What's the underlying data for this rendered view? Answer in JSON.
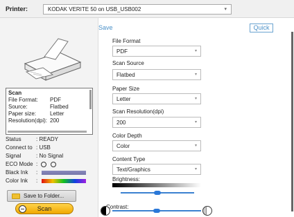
{
  "printer": {
    "label": "Printer:",
    "selected": "KODAK VERITE 50 on USB_USB002"
  },
  "scan_summary": {
    "title": "Scan",
    "rows": [
      {
        "key": "File Format:",
        "value": "PDF"
      },
      {
        "key": "Source:",
        "value": "Flatbed"
      },
      {
        "key": "Paper size:",
        "value": "Letter"
      },
      {
        "key": "Resolution(dpi):",
        "value": "200"
      }
    ]
  },
  "status": {
    "status_label": "Status",
    "status_value": ": READY",
    "connect_label": "Connect to",
    "connect_value": ": USB",
    "signal_label": "Signal",
    "signal_value": ": No Signal",
    "eco_label": "ECO Mode",
    "eco_sep": ":",
    "black_ink_label": "Black Ink",
    "black_ink_sep": ":",
    "color_ink_label": "Color Ink",
    "color_ink_sep": ":"
  },
  "buttons": {
    "save_to_folder": "Save to Folder...",
    "scan": "Scan"
  },
  "tabs": {
    "save": "Save",
    "quick": "Quick"
  },
  "settings": {
    "file_format_label": "File Format",
    "file_format_value": "PDF",
    "scan_source_label": "Scan Source",
    "scan_source_value": "Flatbed",
    "paper_size_label": "Paper Size",
    "paper_size_value": "Letter",
    "resolution_label": "Scan Resolution(dpi)",
    "resolution_value": "200",
    "color_depth_label": "Color Depth",
    "color_depth_value": "Color",
    "content_type_label": "Content Type",
    "content_type_value": "Text/Graphics",
    "brightness_label": "Brightness:",
    "brightness_level": 0.5,
    "contrast_label": "Contrast:",
    "contrast_level": 0.5
  },
  "icons": {
    "caret": "▾",
    "eco_on": "circle",
    "eco_off": "circle"
  }
}
